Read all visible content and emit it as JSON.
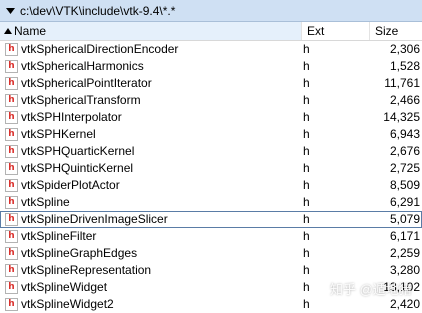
{
  "path_bar": {
    "path": "c:\\dev\\VTK\\include\\vtk-9.4\\*.*"
  },
  "columns": {
    "name": "Name",
    "ext": "Ext",
    "size": "Size"
  },
  "files": [
    {
      "name": "vtkSphericalDirectionEncoder",
      "ext": "h",
      "size": "2,306"
    },
    {
      "name": "vtkSphericalHarmonics",
      "ext": "h",
      "size": "1,528"
    },
    {
      "name": "vtkSphericalPointIterator",
      "ext": "h",
      "size": "11,761"
    },
    {
      "name": "vtkSphericalTransform",
      "ext": "h",
      "size": "2,466"
    },
    {
      "name": "vtkSPHInterpolator",
      "ext": "h",
      "size": "14,325"
    },
    {
      "name": "vtkSPHKernel",
      "ext": "h",
      "size": "6,943"
    },
    {
      "name": "vtkSPHQuarticKernel",
      "ext": "h",
      "size": "2,676"
    },
    {
      "name": "vtkSPHQuinticKernel",
      "ext": "h",
      "size": "2,725"
    },
    {
      "name": "vtkSpiderPlotActor",
      "ext": "h",
      "size": "8,509"
    },
    {
      "name": "vtkSpline",
      "ext": "h",
      "size": "6,291"
    },
    {
      "name": "vtkSplineDrivenImageSlicer",
      "ext": "h",
      "size": "5,079"
    },
    {
      "name": "vtkSplineFilter",
      "ext": "h",
      "size": "6,171"
    },
    {
      "name": "vtkSplineGraphEdges",
      "ext": "h",
      "size": "2,259"
    },
    {
      "name": "vtkSplineRepresentation",
      "ext": "h",
      "size": "3,280"
    },
    {
      "name": "vtkSplineWidget",
      "ext": "h",
      "size": "13,102"
    },
    {
      "name": "vtkSplineWidget2",
      "ext": "h",
      "size": "2,420"
    }
  ],
  "selected_index": 10,
  "file_icon": {
    "name": "header-file-icon",
    "letter": "h",
    "color": "#d9302c"
  },
  "watermark": "知乎 @遁地猪",
  "colors": {
    "path_bar_bg": "#cfe0f3",
    "selection_border": "#5a7ca6"
  }
}
